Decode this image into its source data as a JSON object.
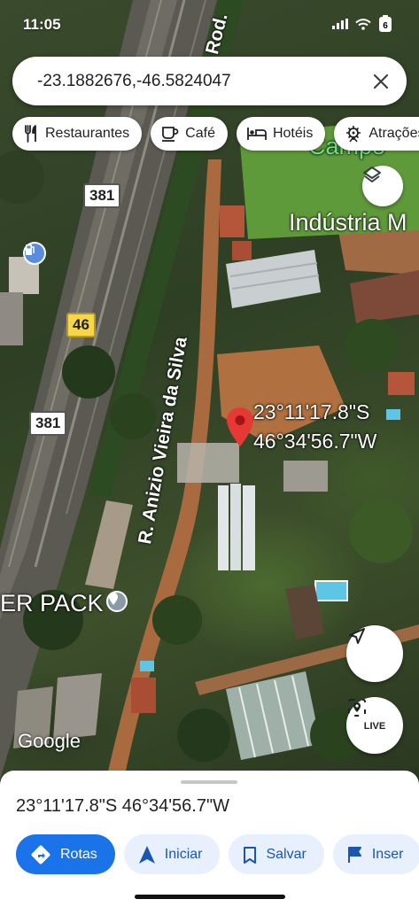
{
  "status_bar": {
    "time": "11:05"
  },
  "search": {
    "query": "-23.1882676,-46.5824047"
  },
  "chips": [
    {
      "icon": "restaurant-icon",
      "label": "Restaurantes"
    },
    {
      "icon": "coffee-icon",
      "label": "Café"
    },
    {
      "icon": "hotel-icon",
      "label": "Hotéis"
    },
    {
      "icon": "attractions-icon",
      "label": "Atrações"
    }
  ],
  "map_labels": {
    "street_rod": "Rod.",
    "place_campo": "Campo",
    "place_industria": "Indústria M",
    "street_anizio": "R. Anizio Vieira da Silva",
    "shield_381_top": "381",
    "shield_46": "46",
    "shield_381_bottom": "381",
    "business_pack": "ER PACK",
    "google": "Google"
  },
  "pin": {
    "lat_label": "23°11'17.8\"S",
    "lon_label": "46°34'56.7\"W"
  },
  "buttons": {
    "live_label": "LIVE"
  },
  "sheet": {
    "title": "23°11'17.8\"S 46°34'56.7\"W",
    "actions": [
      {
        "icon": "directions-icon",
        "label": "Rotas"
      },
      {
        "icon": "navigation-icon",
        "label": "Iniciar"
      },
      {
        "icon": "bookmark-icon",
        "label": "Salvar"
      },
      {
        "icon": "flag-icon",
        "label": "Inser"
      }
    ]
  },
  "colors": {
    "accent": "#1a73e8",
    "pin": "#e53935",
    "chip_bg": "#ffffff"
  }
}
